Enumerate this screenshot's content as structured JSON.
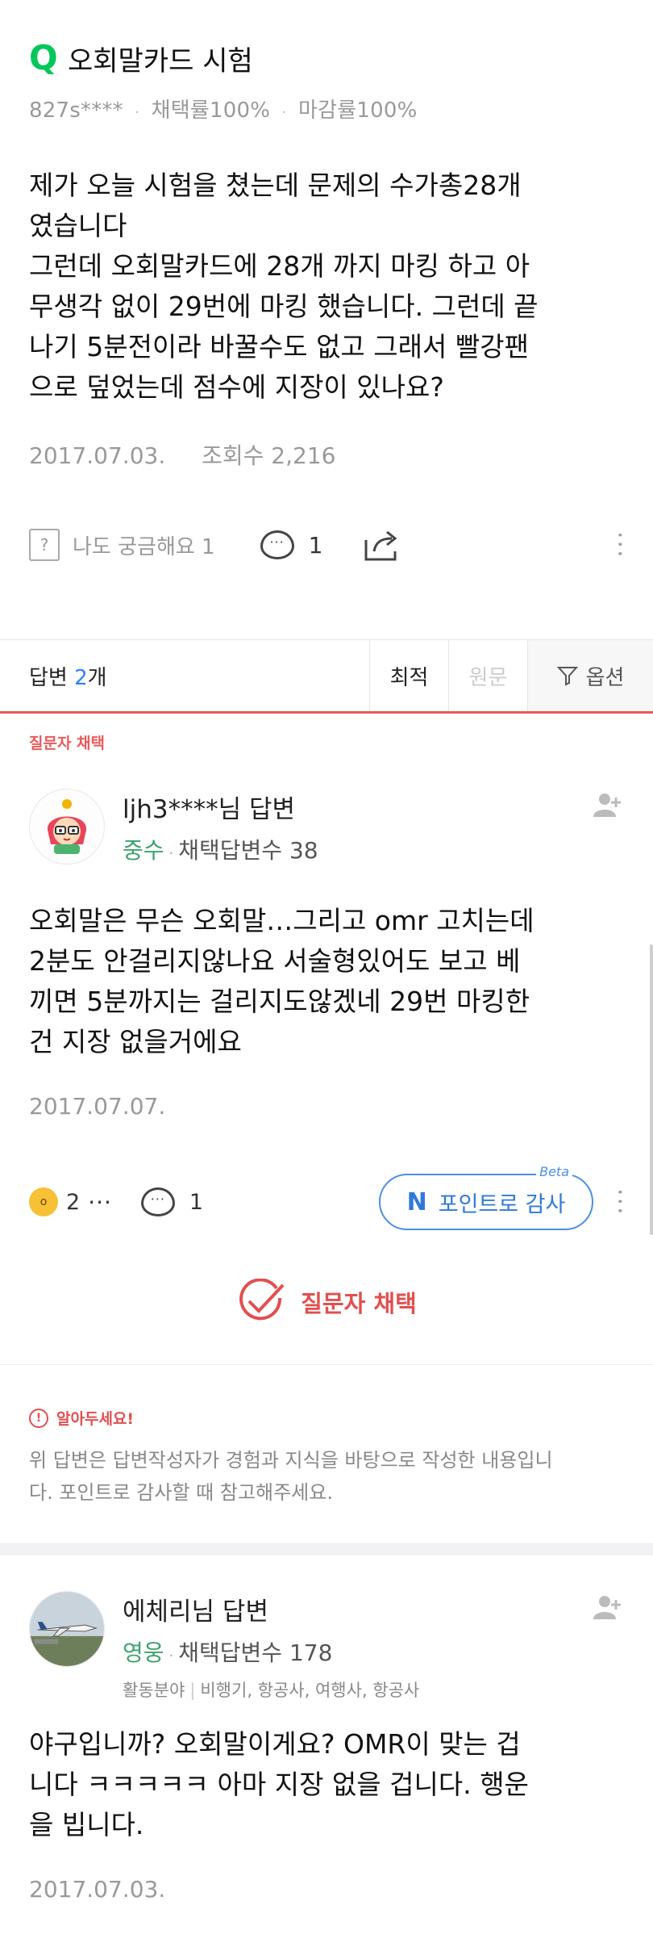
{
  "question": {
    "mark": "Q",
    "title": "오회말카드 시험",
    "author": "827s****",
    "choose_rate": "채택률100%",
    "close_rate": "마감률100%",
    "body_lines": [
      "제가 오늘 시험을 쳤는데 문제의 수가총28개",
      "였습니다",
      "그런데 오회말카드에 28개 까지 마킹 하고 아",
      "무생각 없이 29번에 마킹 했습니다. 그런데 끝",
      "나기 5분전이라 바꿀수도 없고 그래서 빨강팬",
      "으로 덮었는데 점수에 지장이 있나요?"
    ],
    "date": "2017.07.03.",
    "views": "조회수 2,216",
    "curious_label": "나도 궁금해요 1",
    "comment_count": "1"
  },
  "answers_bar": {
    "label_prefix": "답변 ",
    "count": "2",
    "label_suffix": "개",
    "sort_best": "최적",
    "sort_original": "원문",
    "options": "옵션"
  },
  "answer1": {
    "chosen_label": "질문자 채택",
    "author": "ljh3****님 답변",
    "rank": "중수",
    "chosen_count": "채택답변수 38",
    "body_lines": [
      "오회말은 무슨 오회말…그리고 omr 고치는데",
      "2분도 안걸리지않나요 서술형있어도 보고 베",
      "끼면 5분까지는 걸리지도않겠네 29번 마킹한",
      "건 지장 없을거에요"
    ],
    "date": "2017.07.07.",
    "reaction_count": "2",
    "reaction_more": "···",
    "comment_count": "1",
    "point_button": "포인트로 감사",
    "beta": "Beta",
    "chosen_badge": "질문자 채택"
  },
  "notice": {
    "title": "알아두세요!",
    "lines": [
      "위 답변은 답변작성자가 경험과 지식을 바탕으로 작성한 내용입니",
      "다. 포인트로 감사할 때 참고해주세요."
    ]
  },
  "answer2": {
    "author": "에체리님 답변",
    "rank": "영웅",
    "chosen_count": "채택답변수 178",
    "field_label": "활동분야",
    "field_values": "비행기, 항공사, 여행사, 항공사",
    "body_lines": [
      "야구입니까? 오회말이게요? OMR이 맞는 겁",
      "니다 ㅋㅋㅋㅋㅋ 아마 지장 없을 겁니다. 행운",
      "을 빕니다."
    ],
    "date": "2017.07.03."
  },
  "colors": {
    "accent_green": "#03c75a",
    "chosen_red": "#e24f4f",
    "point_blue": "#2f7ad9",
    "rank_green": "#3aa36b"
  }
}
